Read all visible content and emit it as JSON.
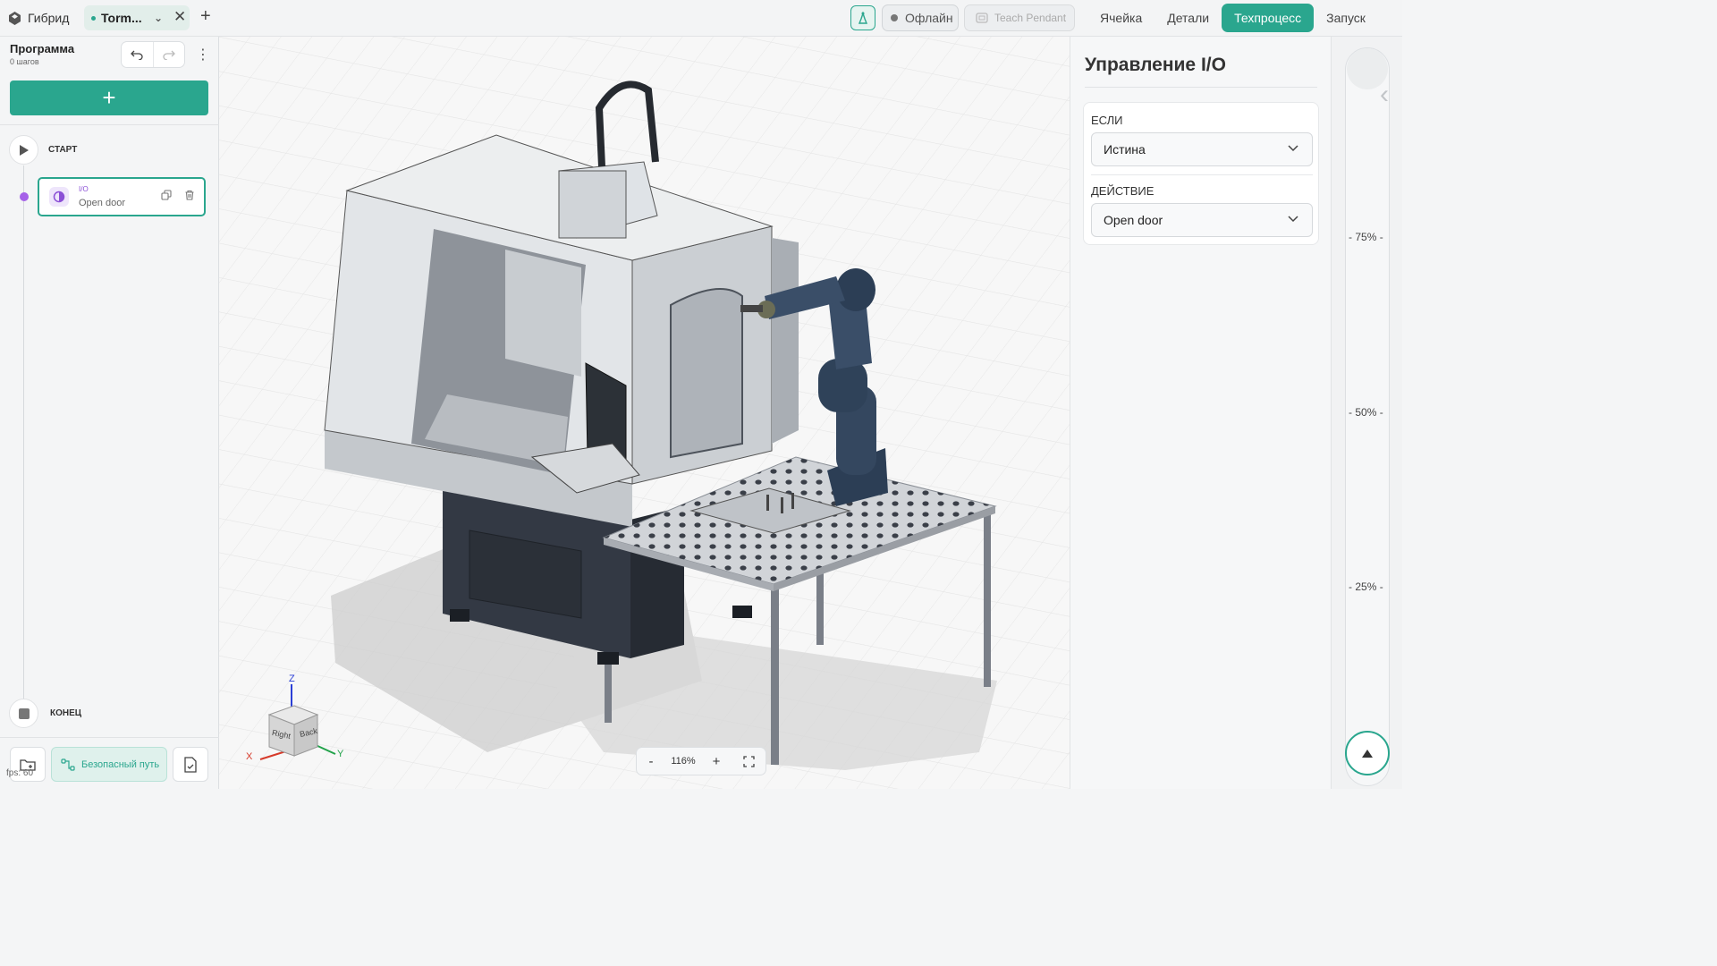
{
  "app": {
    "name": "Гибрид"
  },
  "tabs": [
    {
      "label": "Torm..."
    }
  ],
  "topbar": {
    "status_label": "Офлайн",
    "teach_label": "Teach Pendant",
    "modes": [
      "Ячейка",
      "Детали",
      "Техпроцесс",
      "Запуск"
    ],
    "active_mode": "Техпроцесс"
  },
  "sidebar": {
    "title": "Программа",
    "subtitle": "0 шагов",
    "start_label": "СТАРТ",
    "end_label": "КОНЕЦ",
    "steps": [
      {
        "type": "I/O",
        "name": "Open door"
      }
    ],
    "safe_path_label": "Безопасный путь",
    "fps_label": "fps: 60"
  },
  "viewport": {
    "zoom_value": "116%",
    "zoom_minus": "-",
    "zoom_plus": "+",
    "axes": {
      "x": "X",
      "y": "Y",
      "z": "Z"
    },
    "cube_faces": {
      "right": "Right",
      "back": "Back"
    }
  },
  "panel": {
    "title": "Управление I/O",
    "if_label": "ЕСЛИ",
    "if_value": "Истина",
    "action_label": "ДЕЙСТВИЕ",
    "action_value": "Open door"
  },
  "rail": {
    "ticks": [
      "75%",
      "50%",
      "25%"
    ]
  },
  "colors": {
    "accent": "#2aa68e",
    "io_purple": "#a561e8"
  }
}
